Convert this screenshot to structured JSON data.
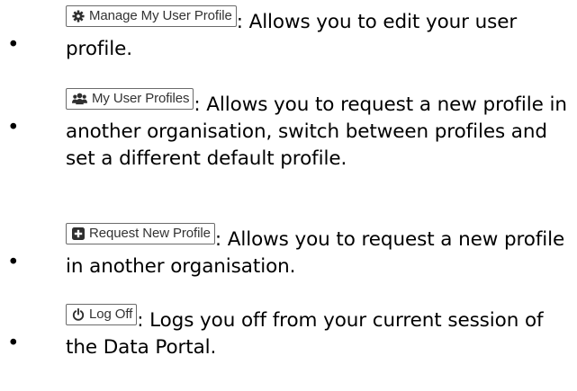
{
  "items": [
    {
      "button_label": "Manage My User Profile",
      "button_icon": "gear-icon",
      "description": ": Allows you to edit your user profile."
    },
    {
      "button_label": "My User Profiles",
      "button_icon": "users-icon",
      "description": ": Allows you to request a new profile in another organisation, switch between profiles and set a different default profile."
    },
    {
      "button_label": "Request New Profile",
      "button_icon": "plus-square-icon",
      "description": ": Allows you to request a new profile in another organisation."
    },
    {
      "button_label": "Log Off",
      "button_icon": "power-icon",
      "description": ": Logs you off from your current session of the Data Portal."
    }
  ],
  "bullet": "•",
  "colors": {
    "text": "#000000",
    "button_border": "#6b6b6b",
    "button_text": "#333333",
    "icon": "#2f2f2f"
  }
}
